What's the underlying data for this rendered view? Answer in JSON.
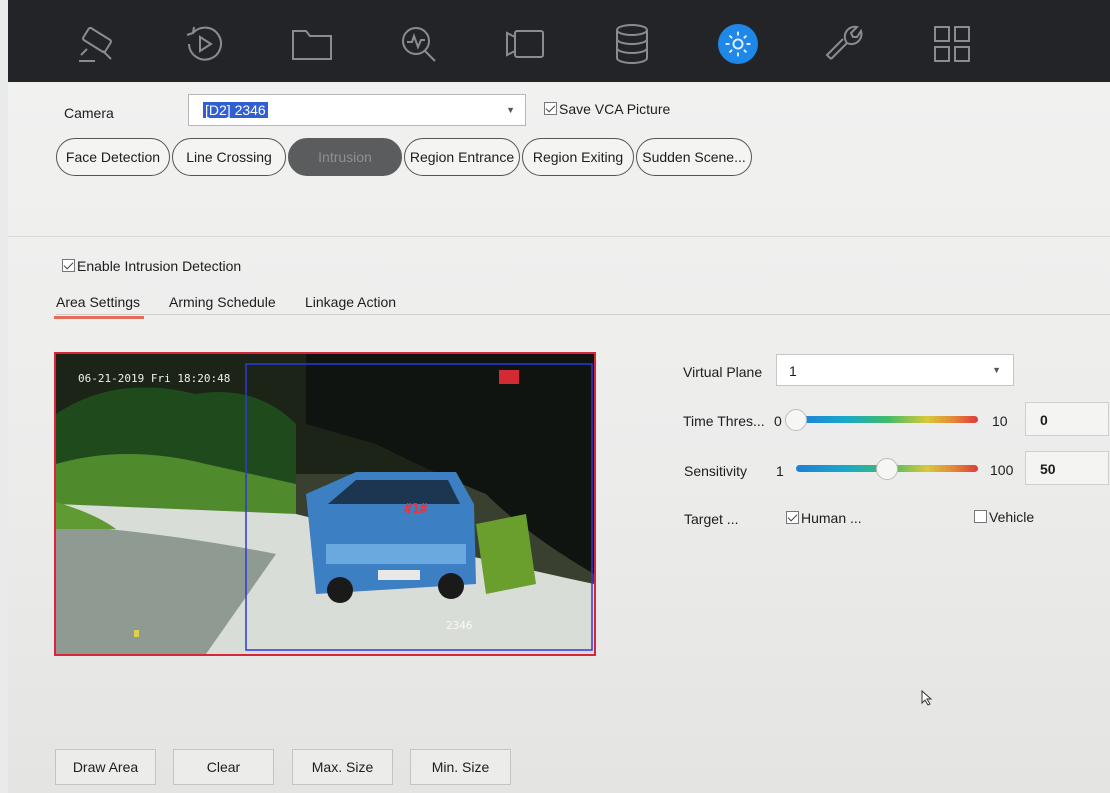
{
  "toolbar": {
    "icons": [
      {
        "name": "live-view-camera-icon",
        "active": false
      },
      {
        "name": "playback-icon",
        "active": false
      },
      {
        "name": "file-management-icon",
        "active": false
      },
      {
        "name": "smart-search-icon",
        "active": false
      },
      {
        "name": "camera-management-icon",
        "active": false
      },
      {
        "name": "storage-icon",
        "active": false
      },
      {
        "name": "settings-gear-icon",
        "active": true
      },
      {
        "name": "maintenance-wrench-icon",
        "active": false
      },
      {
        "name": "apps-grid-icon",
        "active": false
      }
    ],
    "accent_color": "#1e87e8"
  },
  "camera": {
    "label": "Camera",
    "value": "[D2] 2346",
    "save_vca_label": "Save VCA Picture",
    "save_vca_checked": true
  },
  "vca_tabs": [
    {
      "label": "Face Detection",
      "active": false
    },
    {
      "label": "Line Crossing",
      "active": false
    },
    {
      "label": "Intrusion",
      "active": true
    },
    {
      "label": "Region Entrance",
      "active": false
    },
    {
      "label": "Region Exiting",
      "active": false
    },
    {
      "label": "Sudden Scene...",
      "active": false
    }
  ],
  "enable": {
    "label": "Enable Intrusion Detection",
    "checked": true
  },
  "subtabs": [
    {
      "label": "Area Settings",
      "active": true
    },
    {
      "label": "Arming Schedule",
      "active": false
    },
    {
      "label": "Linkage Action",
      "active": false
    }
  ],
  "preview": {
    "timestamp": "06-21-2019 Fri 18:20:48",
    "camera_name": "2346",
    "region_tag": "#1#"
  },
  "settings": {
    "virtual_plane_label": "Virtual Plane",
    "virtual_plane_value": "1",
    "time_threshold": {
      "label": "Time Thres...",
      "min": "0",
      "max": "10",
      "value": "0",
      "fraction": 0.0
    },
    "sensitivity": {
      "label": "Sensitivity",
      "min": "1",
      "max": "100",
      "value": "50",
      "fraction": 0.5
    },
    "target_label": "Target ...",
    "human_label": "Human ...",
    "human_checked": true,
    "vehicle_label": "Vehicle",
    "vehicle_checked": false
  },
  "buttons": {
    "draw_area": "Draw Area",
    "clear": "Clear",
    "max_size": "Max. Size",
    "min_size": "Min. Size"
  }
}
